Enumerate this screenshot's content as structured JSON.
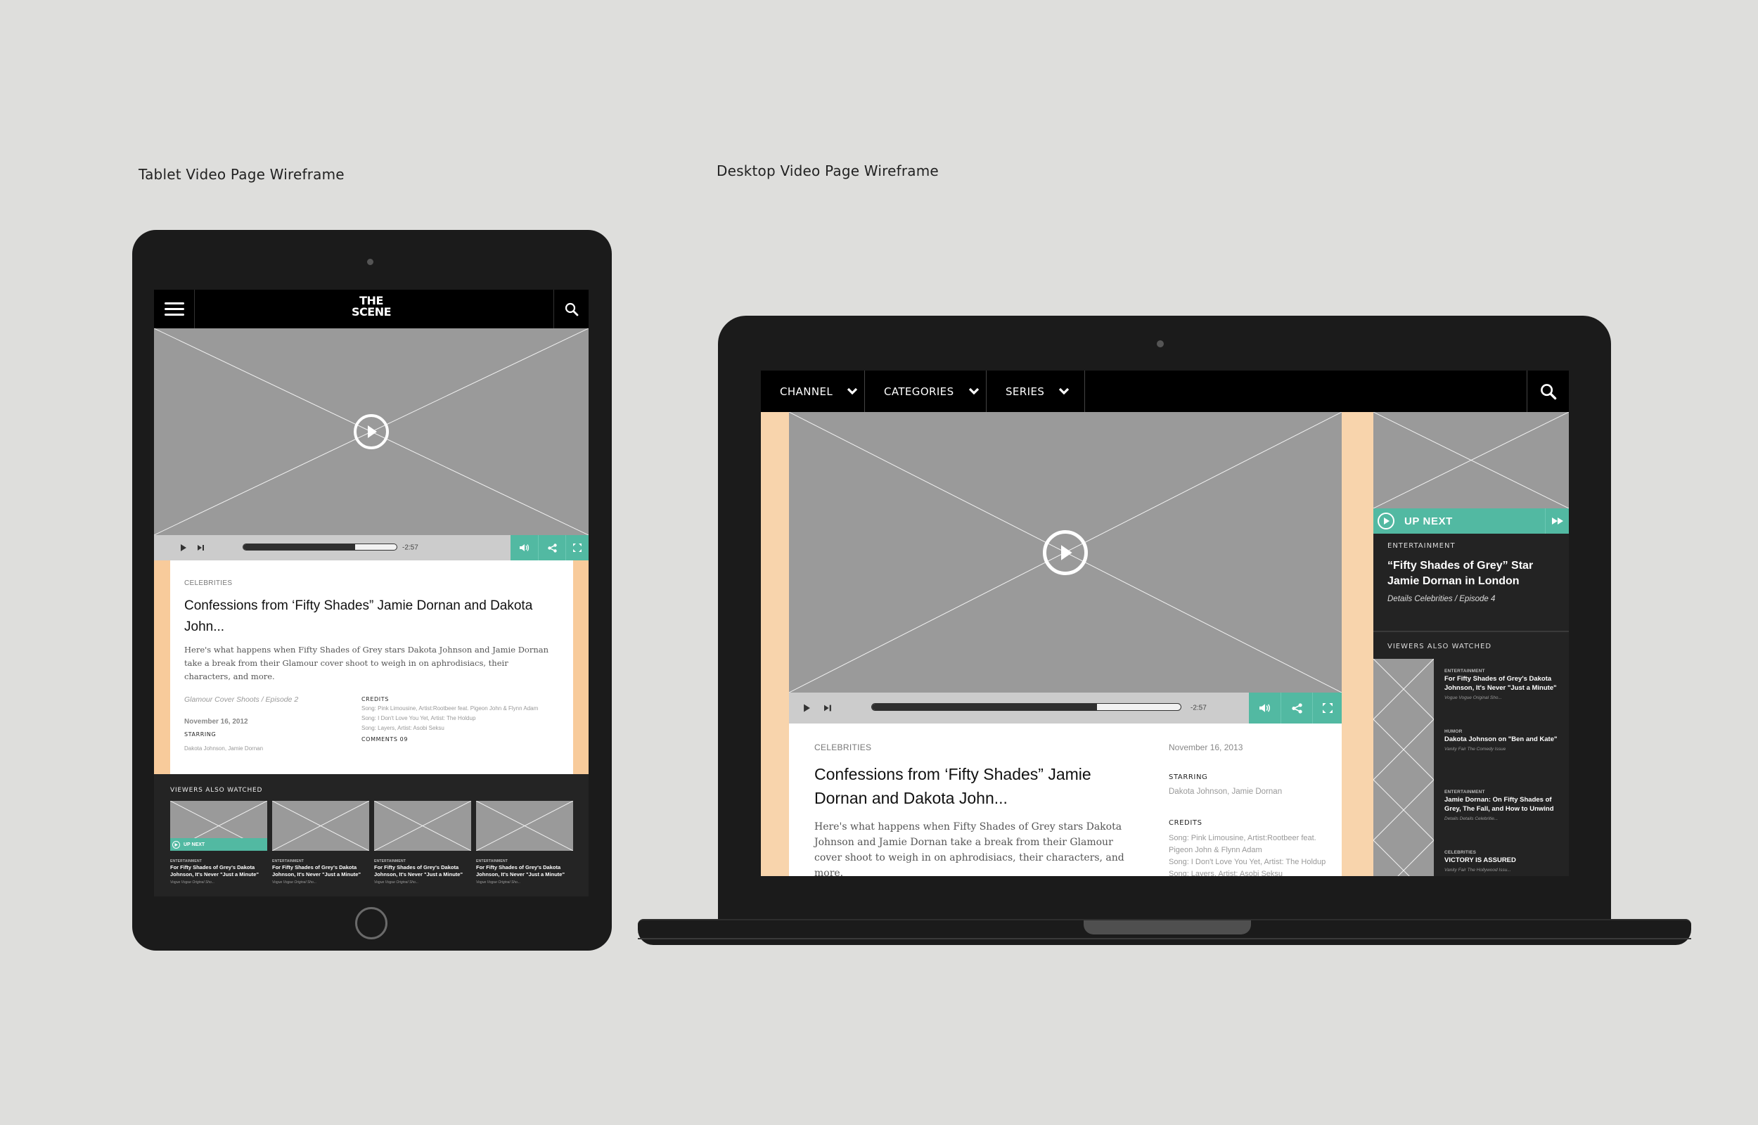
{
  "captions": {
    "tablet": "Tablet Video Page Wireframe",
    "desktop": "Desktop Video Page Wireframe"
  },
  "colors": {
    "accent_teal": "#52b9a2",
    "peach": "#f8cb9b",
    "placeholder_gray": "#9a9a9a",
    "device_frame": "#1b1b1b",
    "background": "#dededc"
  },
  "tablet": {
    "logo_line1": "THE",
    "logo_line2": "SCENE",
    "player": {
      "time_remaining": "-2:57",
      "progress": 0.73
    },
    "article": {
      "category": "CELEBRITIES",
      "title": "Confessions from ‘Fifty Shades” Jamie Dornan and Dakota John...",
      "description": "Here's what happens when Fifty Shades of Grey stars Dakota Johnson and Jamie Dornan take a break from their Glamour cover shoot to weigh in on aphrodisiacs, their characters, and more.",
      "series": "Glamour Cover Shoots /  Episode 2",
      "date": "November 16, 2012",
      "starring_label": "STARRING",
      "starring": "Dakota Johnson, Jamie Dornan",
      "credits_label": "CREDITS",
      "credits": [
        "Song: Pink Limousine, Artist:Rootbeer feat. Pigeon John & Flynn Adam",
        "Song: I Don't Love You Yet, Artist: The Holdup",
        "Song: Layers, Artist: Asobi Seksu"
      ],
      "comments": "COMMENTS 09"
    },
    "related": {
      "heading": "VIEWERS ALSO WATCHED",
      "up_next_label": "UP NEXT",
      "items": [
        {
          "category": "ENTERTAINMENT",
          "title": "For Fifty Shades of Grey's Dakota Johnson, It's Never \"Just a Minute\"",
          "source": "Vogue  Vogue Original Sho..."
        },
        {
          "category": "ENTERTAINMENT",
          "title": "For Fifty Shades of Grey's Dakota Johnson, It's Never \"Just a Minute\"",
          "source": "Vogue  Vogue Original Sho..."
        },
        {
          "category": "ENTERTAINMENT",
          "title": "For Fifty Shades of Grey's Dakota Johnson, It's Never \"Just a Minute\"",
          "source": "Vogue  Vogue Original Sho..."
        },
        {
          "category": "ENTERTAINMENT",
          "title": "For Fifty Shades of Grey's Dakota Johnson, It's Never \"Just a Minute\"",
          "source": "Vogue  Vogue Original Sho..."
        }
      ]
    }
  },
  "desktop": {
    "nav": [
      "CHANNEL",
      "CATEGORIES",
      "SERIES"
    ],
    "player": {
      "time_remaining": "-2:57",
      "progress": 0.73
    },
    "article": {
      "category": "CELEBRITIES",
      "title": "Confessions from ‘Fifty Shades” Jamie Dornan and Dakota John...",
      "description": "Here's what happens when Fifty Shades of Grey stars Dakota Johnson and Jamie Dornan take a break from their Glamour cover shoot to weigh in on aphrodisiacs, their characters, and more.",
      "date": "November 16, 2013",
      "starring_label": "STARRING",
      "starring": "Dakota Johnson, Jamie Dornan",
      "credits_label": "CREDITS",
      "credits": [
        "Song: Pink Limousine, Artist:Rootbeer feat. Pigeon John & Flynn Adam",
        "Song: I Don't Love You Yet, Artist: The Holdup",
        "Song: Layers, Artist: Asobi Seksu"
      ]
    },
    "up_next": {
      "label": "UP NEXT",
      "category": "ENTERTAINMENT",
      "title": "“Fifty Shades of Grey” Star Jamie Dornan in London",
      "series": "Details Celebrities /  Episode 4"
    },
    "related": {
      "heading": "VIEWERS ALSO WATCHED",
      "items": [
        {
          "category": "ENTERTAINMENT",
          "title": "For Fifty Shades of Grey's Dakota Johnson, It's Never \"Just a Minute\"",
          "source": "Vogue  Vogue Original Sho..."
        },
        {
          "category": "HUMOR",
          "title": "Dakota Johnson on \"Ben and Kate\"",
          "source": "Vanity Fair  The Comedy Issue"
        },
        {
          "category": "ENTERTAINMENT",
          "title": "Jamie Dornan: On Fifty Shades of Grey, The Fall, and How to Unwind",
          "source": "Details  Details Celebritie..."
        },
        {
          "category": "CELEBRITIES",
          "title": "VICTORY IS ASSURED",
          "source": "Vanity Fair  The Hollywood Issu..."
        }
      ]
    }
  }
}
